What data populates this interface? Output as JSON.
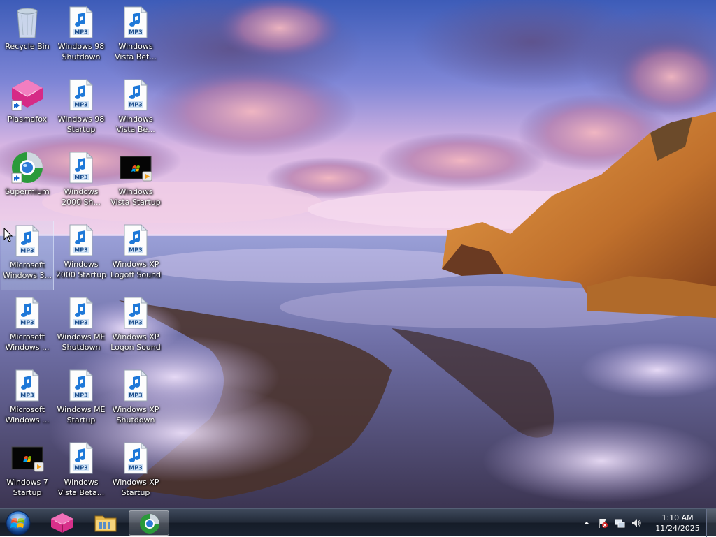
{
  "desktop": {
    "icons": [
      {
        "label": "Recycle Bin",
        "type": "recycle-bin"
      },
      {
        "label": "Plasmafox",
        "type": "plasmafox"
      },
      {
        "label": "Supermium",
        "type": "supermium"
      },
      {
        "label": "Microsoft\nWindows 3...",
        "type": "mp3"
      },
      {
        "label": "Microsoft\nWindows ...",
        "type": "mp3"
      },
      {
        "label": "Microsoft\nWindows ...",
        "type": "mp3"
      },
      {
        "label": "Windows 7\nStartup",
        "type": "video"
      },
      {
        "label": "Windows 98\nShutdown",
        "type": "mp3"
      },
      {
        "label": "Windows 98\nStartup",
        "type": "mp3"
      },
      {
        "label": "Windows\n2000 Sh...",
        "type": "mp3"
      },
      {
        "label": "Windows\n2000 Startup",
        "type": "mp3"
      },
      {
        "label": "Windows ME\nShutdown",
        "type": "mp3"
      },
      {
        "label": "Windows ME\nStartup",
        "type": "mp3"
      },
      {
        "label": "Windows\nVista Beta...",
        "type": "mp3"
      },
      {
        "label": "Windows\nVista Bet...",
        "type": "mp3"
      },
      {
        "label": "Windows\nVista Be...",
        "type": "mp3"
      },
      {
        "label": "Windows\nVista Startup",
        "type": "video"
      },
      {
        "label": "Windows XP\nLogoff Sound",
        "type": "mp3"
      },
      {
        "label": "Windows XP\nLogon Sound",
        "type": "mp3"
      },
      {
        "label": "Windows XP\nShutdown",
        "type": "mp3"
      },
      {
        "label": "Windows XP\nStartup",
        "type": "mp3"
      }
    ],
    "mp3_badge": "MP3"
  },
  "taskbar": {
    "pinned": [
      {
        "name": "start-button"
      },
      {
        "name": "plasmafox-taskbar-button"
      },
      {
        "name": "file-explorer-taskbar-button"
      },
      {
        "name": "supermium-taskbar-button"
      }
    ],
    "clock": {
      "time": "1:10 AM",
      "date": "11/24/2025"
    }
  },
  "colors": {
    "taskbar_dark": "#151c28",
    "sky_top": "#4a6fc0",
    "cloud_pink": "#e0a0c0",
    "sea": "#7a80b8",
    "cliff": "#d98a3a"
  }
}
